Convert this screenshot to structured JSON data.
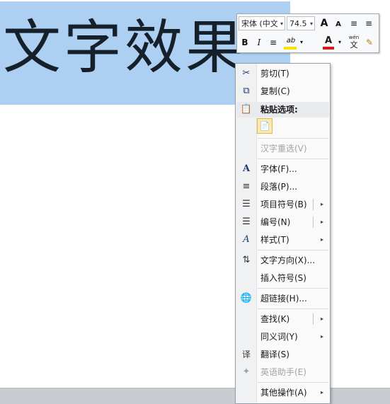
{
  "document": {
    "selected_text": "文字效果"
  },
  "mini_toolbar": {
    "font_name": "宋体 (中文",
    "font_size": "74.5",
    "combo_arrow": "▾",
    "grow_font_icon": "A",
    "shrink_font_icon": "A",
    "decrease_indent_icon": "≡",
    "increase_indent_icon": "≡",
    "bold": "B",
    "italic": "I",
    "center_icon": "≡",
    "highlight_icon": "ab",
    "font_color_icon": "A",
    "phonetic_text": "wén",
    "phonetic_char": "文",
    "format_painter_icon": "✎",
    "accent_colors": {
      "highlight": "#f4e600",
      "font_color": "#d21c1c"
    }
  },
  "context_menu": {
    "submenu_arrow": "▸",
    "items": [
      {
        "label": "剪切(T)",
        "icon": "scissors-icon",
        "glyph": "✂",
        "enabled": true
      },
      {
        "label": "复制(C)",
        "icon": "copy-icon",
        "glyph": "⧉",
        "enabled": true
      },
      {
        "label": "粘贴选项:",
        "icon": "clipboard-icon",
        "glyph": "📋",
        "heading": true
      },
      {
        "label": "汉字重选(V)",
        "icon": "",
        "enabled": false
      },
      {
        "label": "字体(F)...",
        "icon": "font-icon",
        "glyph": "A",
        "enabled": true
      },
      {
        "label": "段落(P)...",
        "icon": "paragraph-icon",
        "glyph": "≡",
        "enabled": true
      },
      {
        "label": "项目符号(B)",
        "icon": "bullets-icon",
        "glyph": "☰",
        "enabled": true,
        "submenu": true
      },
      {
        "label": "编号(N)",
        "icon": "numbering-icon",
        "glyph": "☰",
        "enabled": true,
        "submenu": true
      },
      {
        "label": "样式(T)",
        "icon": "styles-icon",
        "glyph": "A",
        "enabled": true,
        "submenu": true
      },
      {
        "label": "文字方向(X)...",
        "icon": "text-direction-icon",
        "glyph": "⇅",
        "enabled": true
      },
      {
        "label": "插入符号(S)",
        "icon": "",
        "enabled": true
      },
      {
        "label": "超链接(H)...",
        "icon": "hyperlink-icon",
        "glyph": "🌐",
        "enabled": true
      },
      {
        "label": "查找(K)",
        "icon": "",
        "enabled": true,
        "submenu": true
      },
      {
        "label": "同义词(Y)",
        "icon": "",
        "enabled": true,
        "submenu": true
      },
      {
        "label": "翻译(S)",
        "icon": "translate-icon",
        "glyph": "译",
        "enabled": true
      },
      {
        "label": "英语助手(E)",
        "icon": "english-assistant-icon",
        "glyph": "✦",
        "enabled": false
      },
      {
        "label": "其他操作(A)",
        "icon": "",
        "enabled": true,
        "submenu": true
      }
    ],
    "paste_option_glyph": "📄"
  }
}
